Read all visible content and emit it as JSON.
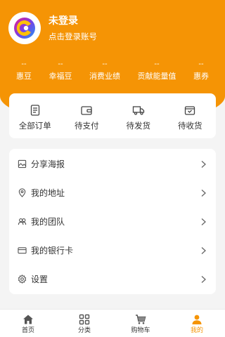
{
  "colors": {
    "accent": "#f59405",
    "text": "#333333",
    "icon": "#555555",
    "background": "#f4f4f4"
  },
  "profile": {
    "name": "未登录",
    "subtitle": "点击登录账号"
  },
  "stats": [
    {
      "value": "--",
      "label": "惠豆"
    },
    {
      "value": "--",
      "label": "幸福豆"
    },
    {
      "value": "--",
      "label": "消费业绩"
    },
    {
      "value": "--",
      "label": "贡献能量值"
    },
    {
      "value": "--",
      "label": "惠券"
    }
  ],
  "orders": [
    {
      "label": "全部订单",
      "icon": "document-icon"
    },
    {
      "label": "待支付",
      "icon": "wallet-icon"
    },
    {
      "label": "待发货",
      "icon": "truck-icon"
    },
    {
      "label": "待收货",
      "icon": "box-icon"
    }
  ],
  "menu": [
    {
      "label": "分享海报",
      "icon": "poster-icon"
    },
    {
      "label": "我的地址",
      "icon": "location-icon"
    },
    {
      "label": "我的团队",
      "icon": "team-icon"
    },
    {
      "label": "我的银行卡",
      "icon": "bank-card-icon"
    },
    {
      "label": "设置",
      "icon": "gear-icon"
    }
  ],
  "tabbar": [
    {
      "label": "首页",
      "icon": "home-icon",
      "active": false
    },
    {
      "label": "分类",
      "icon": "grid-icon",
      "active": false
    },
    {
      "label": "购物车",
      "icon": "cart-icon",
      "active": false
    },
    {
      "label": "我的",
      "icon": "person-icon",
      "active": true
    }
  ]
}
